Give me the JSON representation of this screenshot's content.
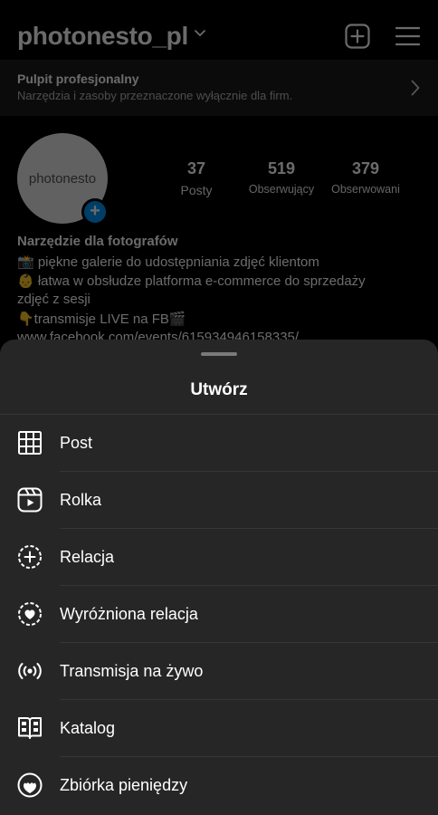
{
  "header": {
    "username": "photonesto_pl",
    "chevron_icon": "chevron-down-icon",
    "create_icon": "plus-square-icon",
    "menu_icon": "hamburger-menu-icon"
  },
  "pulpit": {
    "title": "Pulpit profesjonalny",
    "subtitle": "Narzędzia i zasoby przeznaczone wyłącznie dla firm.",
    "arrow_icon": "chevron-right-icon"
  },
  "profile": {
    "avatar_text": "photonesto",
    "stats": [
      {
        "value": "37",
        "label": "Posty"
      },
      {
        "value": "519",
        "label": "Obserwujący"
      },
      {
        "value": "379",
        "label": "Obserwowani"
      }
    ],
    "bio_title": "Narzędzie dla fotografów",
    "bio_lines": [
      "📸 piękne galerie do udostępniania zdjęć klientom",
      "👶 łatwa w obsłudze platforma e-commerce do sprzedaży",
      "zdjęć z sesji",
      "👇transmisje LIVE na FB🎬",
      "www.facebook.com/events/615934946158335/"
    ]
  },
  "sheet": {
    "title": "Utwórz",
    "items": [
      {
        "label": "Post",
        "icon": "grid-icon"
      },
      {
        "label": "Rolka",
        "icon": "reels-icon"
      },
      {
        "label": "Relacja",
        "icon": "story-plus-icon"
      },
      {
        "label": "Wyróżniona relacja",
        "icon": "highlight-heart-icon"
      },
      {
        "label": "Transmisja na żywo",
        "icon": "live-broadcast-icon"
      },
      {
        "label": "Katalog",
        "icon": "catalog-book-icon"
      },
      {
        "label": "Zbiórka pieniędzy",
        "icon": "fundraiser-heart-icon"
      }
    ]
  },
  "colors": {
    "background": "#000000",
    "sheet": "#262626",
    "accent": "#0095f6"
  }
}
